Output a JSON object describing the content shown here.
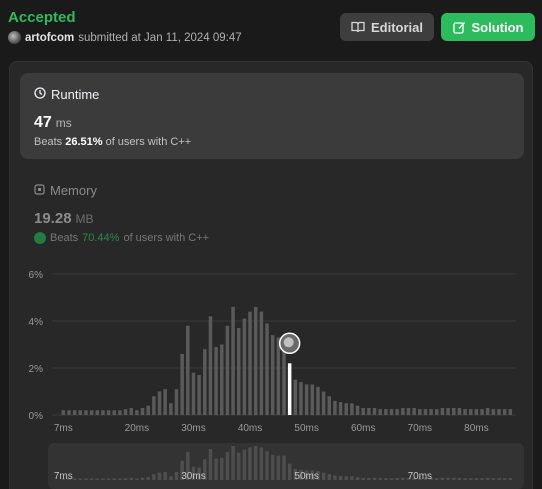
{
  "header": {
    "status": "Accepted",
    "username": "artofcom",
    "submitted_text": "submitted at Jan 11, 2024 09:47",
    "editorial_label": "Editorial",
    "solution_label": "Solution"
  },
  "runtime": {
    "title": "Runtime",
    "value": "47",
    "unit": "ms",
    "beats_prefix": "Beats",
    "beats_value": "26.51%",
    "beats_suffix": "of users with C++"
  },
  "memory": {
    "title": "Memory",
    "value": "19.28",
    "unit": "MB",
    "beats_prefix": "Beats",
    "beats_value": "70.44%",
    "beats_suffix": "of users with C++"
  },
  "colors": {
    "accent_green": "#2cbb5d",
    "bar": "#5a5a5a",
    "highlight_bar": "#ffffff"
  },
  "chart_data": {
    "type": "bar",
    "ylabel": "",
    "xlabel": "",
    "ylim": [
      0,
      6
    ],
    "y_ticks": [
      "0%",
      "2%",
      "4%",
      "6%"
    ],
    "y_tick_values": [
      0,
      2,
      4,
      6
    ],
    "x_ticks": [
      "7ms",
      "20ms",
      "30ms",
      "40ms",
      "50ms",
      "60ms",
      "70ms",
      "80ms"
    ],
    "x_tick_values": [
      7,
      20,
      30,
      40,
      50,
      60,
      70,
      80
    ],
    "xlim": [
      5,
      87
    ],
    "x": [
      7,
      8,
      9,
      10,
      11,
      12,
      13,
      14,
      15,
      16,
      17,
      18,
      19,
      20,
      21,
      22,
      23,
      24,
      25,
      26,
      27,
      28,
      29,
      30,
      31,
      32,
      33,
      34,
      35,
      36,
      37,
      38,
      39,
      40,
      41,
      42,
      43,
      44,
      45,
      46,
      47,
      48,
      49,
      50,
      51,
      52,
      53,
      54,
      55,
      56,
      57,
      58,
      59,
      60,
      61,
      62,
      63,
      64,
      65,
      66,
      67,
      68,
      69,
      70,
      71,
      72,
      73,
      74,
      75,
      76,
      77,
      78,
      79,
      80,
      81,
      82,
      83,
      84,
      85,
      86
    ],
    "values": [
      0.2,
      0.2,
      0.2,
      0.2,
      0.2,
      0.2,
      0.2,
      0.2,
      0.2,
      0.2,
      0.2,
      0.25,
      0.3,
      0.2,
      0.3,
      0.4,
      0.8,
      1.0,
      1.1,
      0.5,
      1.1,
      2.6,
      3.8,
      1.8,
      1.7,
      2.8,
      4.2,
      2.9,
      3.0,
      3.8,
      4.6,
      3.7,
      4.1,
      4.4,
      4.6,
      4.4,
      3.9,
      3.4,
      3.3,
      3.3,
      2.2,
      1.5,
      1.4,
      1.3,
      1.3,
      1.2,
      1.0,
      0.8,
      0.6,
      0.55,
      0.5,
      0.5,
      0.4,
      0.3,
      0.3,
      0.3,
      0.25,
      0.25,
      0.25,
      0.25,
      0.3,
      0.3,
      0.3,
      0.25,
      0.25,
      0.25,
      0.25,
      0.3,
      0.3,
      0.3,
      0.3,
      0.25,
      0.25,
      0.25,
      0.25,
      0.3,
      0.25,
      0.25,
      0.25,
      0.25
    ],
    "highlight_x": 47
  }
}
